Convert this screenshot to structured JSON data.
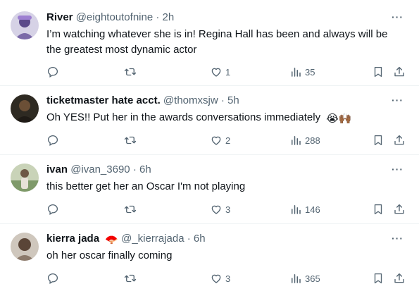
{
  "tweets": [
    {
      "name": "River",
      "handle": "@eightoutofnine",
      "time": "2h",
      "text": "I’m watching whatever she is in! Regina Hall has been and always will be the greatest most dynamic actor",
      "replies": "",
      "retweets": "",
      "likes": "1",
      "views": "35",
      "avatar_color": "#7b6aa8"
    },
    {
      "name": "ticketmaster hate acct.",
      "handle": "@thomxsjw",
      "time": "5h",
      "text": "Oh YES!! Put her in the awards conversations immediately",
      "emoji": "😭🙌🏾",
      "replies": "",
      "retweets": "",
      "likes": "2",
      "views": "288",
      "avatar_color": "#3b3026"
    },
    {
      "name": "ivan",
      "handle": "@ivan_3690",
      "time": "6h",
      "text": "this better get her an Oscar I'm not playing",
      "replies": "",
      "retweets": "",
      "likes": "3",
      "views": "146",
      "avatar_color": "#8aa07a"
    },
    {
      "name": "kierra jada",
      "name_emoji": "🪭",
      "handle": "@_kierrajada",
      "time": "6h",
      "text": "oh her oscar finally coming",
      "replies": "",
      "retweets": "",
      "likes": "3",
      "views": "365",
      "avatar_color": "#5a4537"
    }
  ],
  "separator": "·",
  "more_glyph": "···",
  "icons": [
    "reply-icon",
    "retweet-icon",
    "like-icon",
    "views-icon",
    "bookmark-icon",
    "share-icon",
    "more-icon"
  ]
}
